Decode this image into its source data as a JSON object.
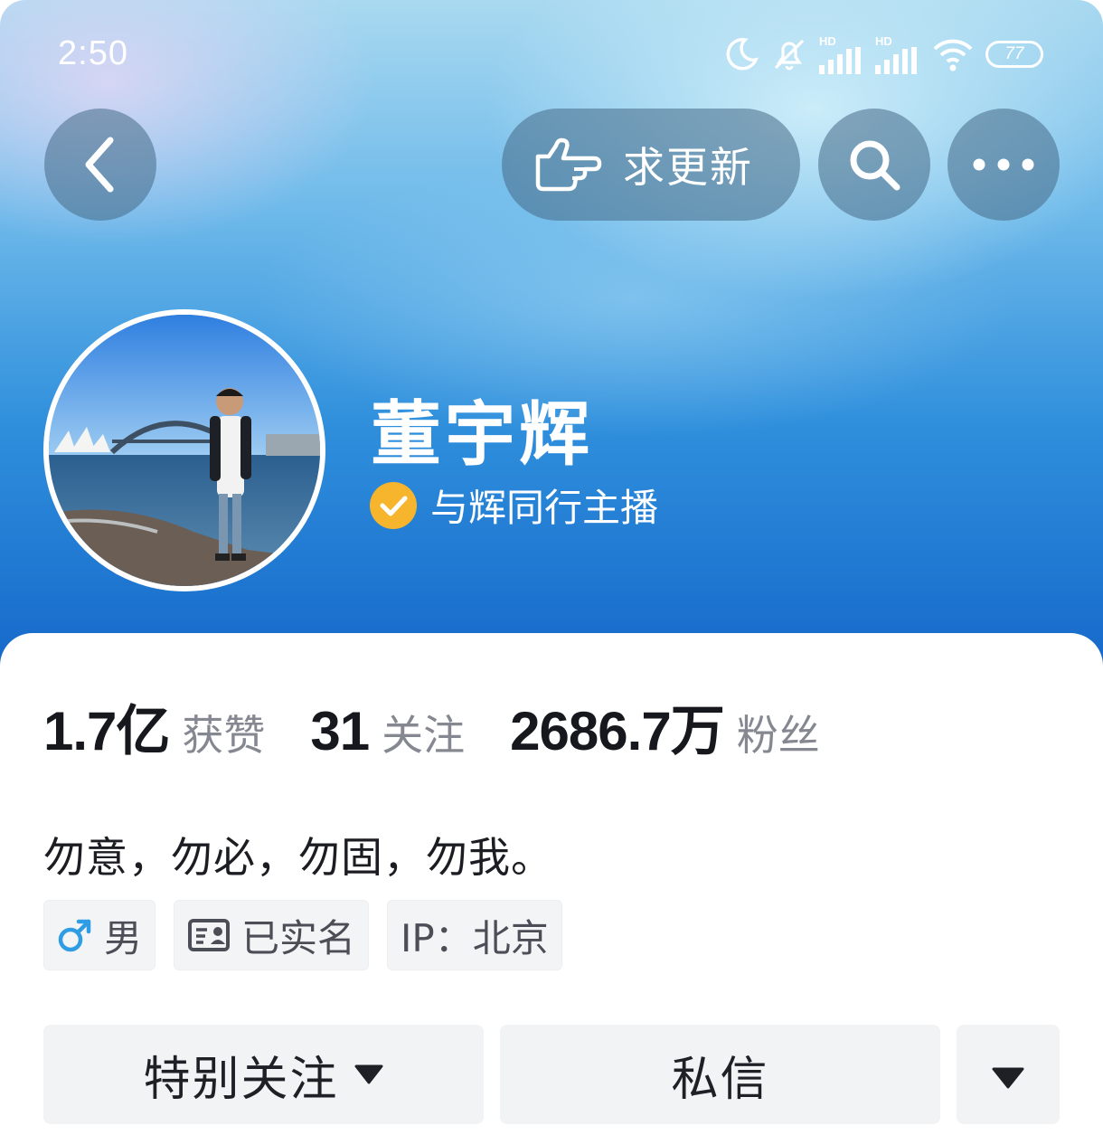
{
  "status_bar": {
    "time": "2:50",
    "network_1": "HD",
    "network_2": "HD",
    "battery": "77"
  },
  "topbar": {
    "back_icon": "chevron-left-icon",
    "update_label": "求更新",
    "update_icon": "pointing-hand-icon",
    "search_icon": "search-icon",
    "more_icon": "more-dots-icon"
  },
  "profile": {
    "name": "董宇辉",
    "verified_icon": "verified-check-icon",
    "verified_label": "与辉同行主播"
  },
  "stats": [
    {
      "value": "1.7亿",
      "label": "获赞"
    },
    {
      "value": "31",
      "label": "关注"
    },
    {
      "value": "2686.7万",
      "label": "粉丝"
    }
  ],
  "bio": "勿意，勿必，勿固，勿我。",
  "tags": {
    "gender": {
      "icon": "male-icon",
      "label": "男"
    },
    "realname": {
      "icon": "id-card-icon",
      "label": "已实名"
    },
    "ip": {
      "label": "IP：北京"
    }
  },
  "actions": {
    "follow_label": "特别关注",
    "message_label": "私信"
  },
  "colors": {
    "hero_top": "#a9d9f0",
    "hero_bottom": "#1466c9",
    "verified": "#f6b52c",
    "male": "#2f9de4"
  }
}
